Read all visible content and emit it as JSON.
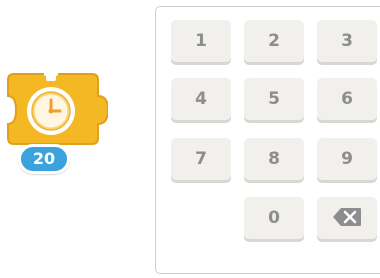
{
  "timer_block": {
    "icon": "stopwatch-icon",
    "value": "20",
    "colors": {
      "block": "#f5b825",
      "block_edge": "#e0a01c",
      "badge": "#3aa3de"
    }
  },
  "keypad": {
    "keys": [
      "1",
      "2",
      "3",
      "4",
      "5",
      "6",
      "7",
      "8",
      "9",
      "0"
    ],
    "backspace_icon": "backspace-icon"
  }
}
